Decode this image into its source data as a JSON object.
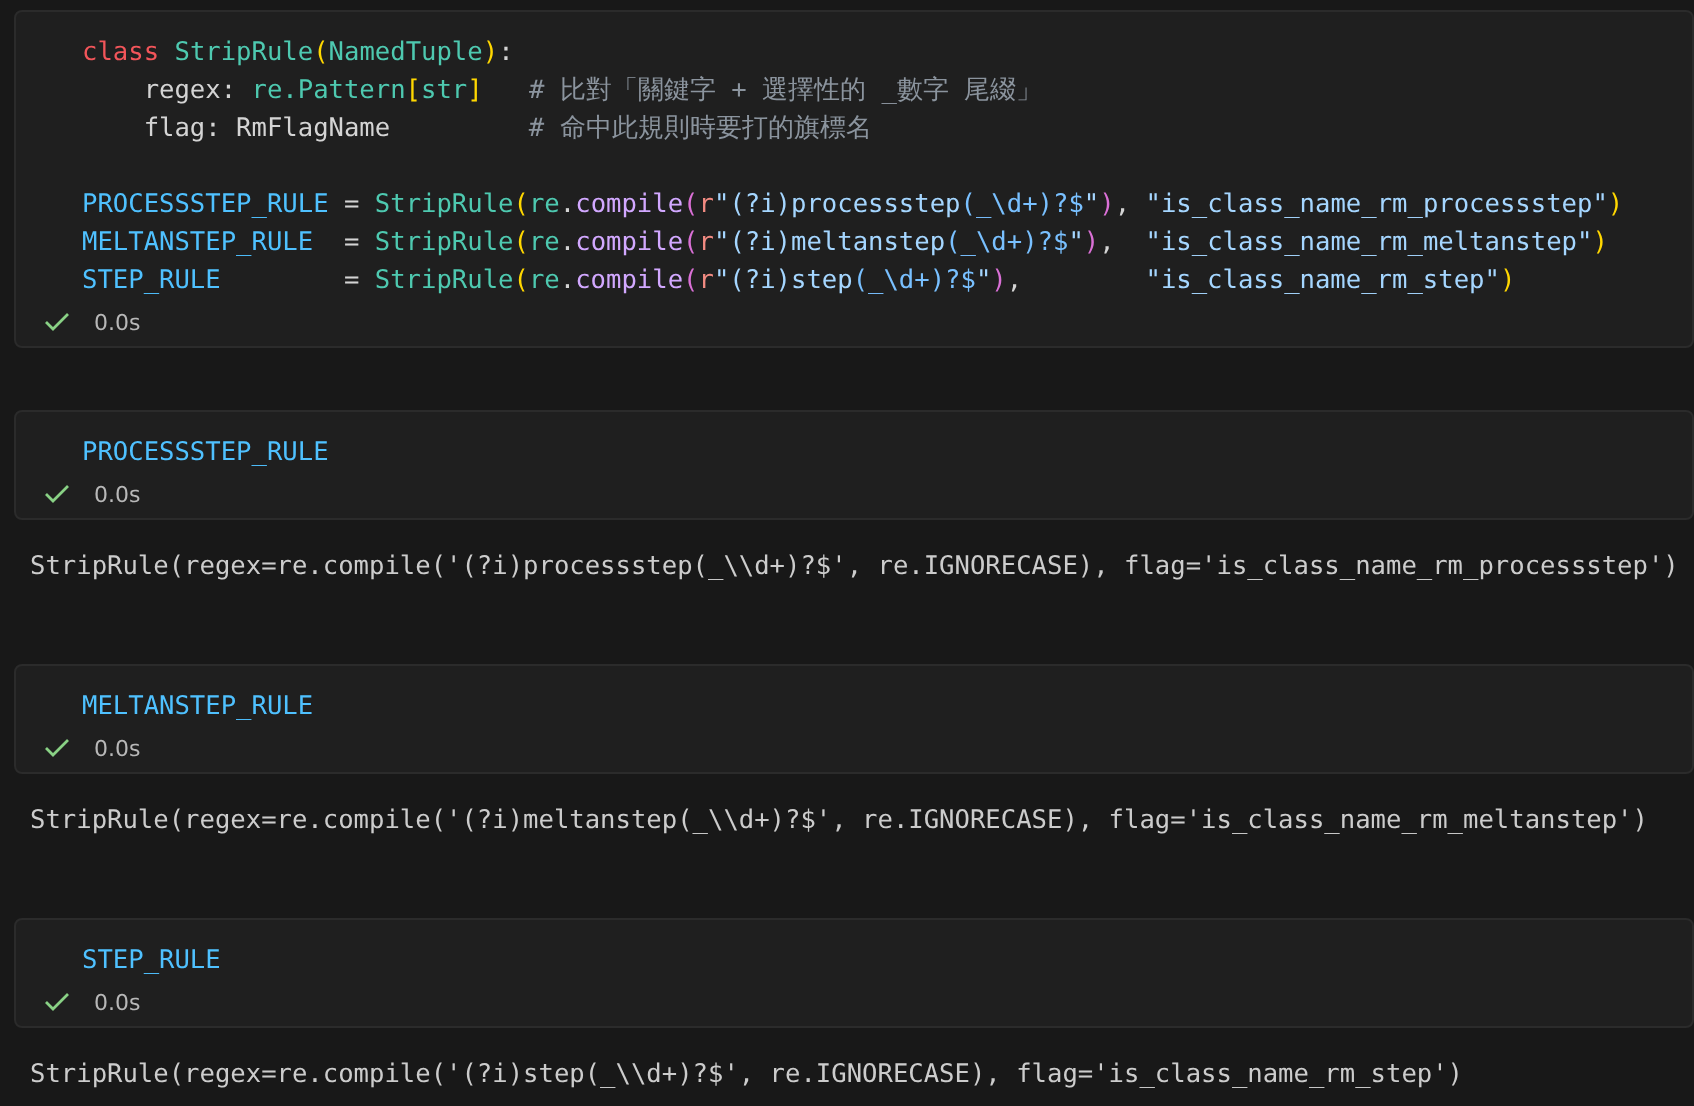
{
  "cells": [
    {
      "code_blocks": [
        [
          [
            {
              "kind": "keyword",
              "text": "class "
            },
            {
              "kind": "type",
              "text": "StripRule"
            },
            {
              "kind": "bracket1",
              "text": "("
            },
            {
              "kind": "type",
              "text": "NamedTuple"
            },
            {
              "kind": "bracket1",
              "text": ")"
            },
            {
              "kind": "plain",
              "text": ":"
            }
          ],
          [
            {
              "kind": "plain",
              "text": "    regex: "
            },
            {
              "kind": "type",
              "text": "re.Pattern"
            },
            {
              "kind": "bracket1",
              "text": "["
            },
            {
              "kind": "type",
              "text": "str"
            },
            {
              "kind": "bracket1",
              "text": "]"
            },
            {
              "kind": "comment",
              "text": "   # 比對「關鍵字 + 選擇性的 _數字 尾綴」"
            }
          ],
          [
            {
              "kind": "plain",
              "text": "    flag: RmFlagName"
            },
            {
              "kind": "comment",
              "text": "         # 命中此規則時要打的旗標名"
            }
          ]
        ],
        [
          [
            {
              "kind": "const",
              "text": "PROCESSSTEP_RULE"
            },
            {
              "kind": "plain",
              "text": " = "
            },
            {
              "kind": "type",
              "text": "StripRule"
            },
            {
              "kind": "bracket1",
              "text": "("
            },
            {
              "kind": "type",
              "text": "re"
            },
            {
              "kind": "plain",
              "text": "."
            },
            {
              "kind": "func",
              "text": "compile"
            },
            {
              "kind": "bracket2",
              "text": "("
            },
            {
              "kind": "prefix",
              "text": "r"
            },
            {
              "kind": "string",
              "text": "\"(?i)processstep"
            },
            {
              "kind": "regex",
              "text": "(_\\d+)?$"
            },
            {
              "kind": "string",
              "text": "\""
            },
            {
              "kind": "bracket2",
              "text": ")"
            },
            {
              "kind": "plain",
              "text": ", "
            },
            {
              "kind": "string",
              "text": "\"is_class_name_rm_processstep\""
            },
            {
              "kind": "bracket1",
              "text": ")"
            }
          ],
          [
            {
              "kind": "const",
              "text": "MELTANSTEP_RULE"
            },
            {
              "kind": "plain",
              "text": "  = "
            },
            {
              "kind": "type",
              "text": "StripRule"
            },
            {
              "kind": "bracket1",
              "text": "("
            },
            {
              "kind": "type",
              "text": "re"
            },
            {
              "kind": "plain",
              "text": "."
            },
            {
              "kind": "func",
              "text": "compile"
            },
            {
              "kind": "bracket2",
              "text": "("
            },
            {
              "kind": "prefix",
              "text": "r"
            },
            {
              "kind": "string",
              "text": "\"(?i)meltanstep"
            },
            {
              "kind": "regex",
              "text": "(_\\d+)?$"
            },
            {
              "kind": "string",
              "text": "\""
            },
            {
              "kind": "bracket2",
              "text": ")"
            },
            {
              "kind": "plain",
              "text": ",  "
            },
            {
              "kind": "string",
              "text": "\"is_class_name_rm_meltanstep\""
            },
            {
              "kind": "bracket1",
              "text": ")"
            }
          ],
          [
            {
              "kind": "const",
              "text": "STEP_RULE"
            },
            {
              "kind": "plain",
              "text": "        = "
            },
            {
              "kind": "type",
              "text": "StripRule"
            },
            {
              "kind": "bracket1",
              "text": "("
            },
            {
              "kind": "type",
              "text": "re"
            },
            {
              "kind": "plain",
              "text": "."
            },
            {
              "kind": "func",
              "text": "compile"
            },
            {
              "kind": "bracket2",
              "text": "("
            },
            {
              "kind": "prefix",
              "text": "r"
            },
            {
              "kind": "string",
              "text": "\"(?i)step"
            },
            {
              "kind": "regex",
              "text": "(_\\d+)?$"
            },
            {
              "kind": "string",
              "text": "\""
            },
            {
              "kind": "bracket2",
              "text": ")"
            },
            {
              "kind": "plain",
              "text": ",        "
            },
            {
              "kind": "string",
              "text": "\"is_class_name_rm_step\""
            },
            {
              "kind": "bracket1",
              "text": ")"
            }
          ]
        ]
      ],
      "status": {
        "succeeded": true,
        "duration": "0.0s"
      }
    },
    {
      "code_blocks": [
        [
          [
            {
              "kind": "const",
              "text": "PROCESSSTEP_RULE"
            }
          ]
        ]
      ],
      "status": {
        "succeeded": true,
        "duration": "0.0s"
      },
      "output": "StripRule(regex=re.compile('(?i)processstep(_\\\\d+)?$', re.IGNORECASE), flag='is_class_name_rm_processstep')"
    },
    {
      "code_blocks": [
        [
          [
            {
              "kind": "const",
              "text": "MELTANSTEP_RULE"
            }
          ]
        ]
      ],
      "status": {
        "succeeded": true,
        "duration": "0.0s"
      },
      "output": "StripRule(regex=re.compile('(?i)meltanstep(_\\\\d+)?$', re.IGNORECASE), flag='is_class_name_rm_meltanstep')"
    },
    {
      "code_blocks": [
        [
          [
            {
              "kind": "const",
              "text": "STEP_RULE"
            }
          ]
        ]
      ],
      "status": {
        "succeeded": true,
        "duration": "0.0s"
      },
      "output": "StripRule(regex=re.compile('(?i)step(_\\\\d+)?$', re.IGNORECASE), flag='is_class_name_rm_step')"
    }
  ]
}
